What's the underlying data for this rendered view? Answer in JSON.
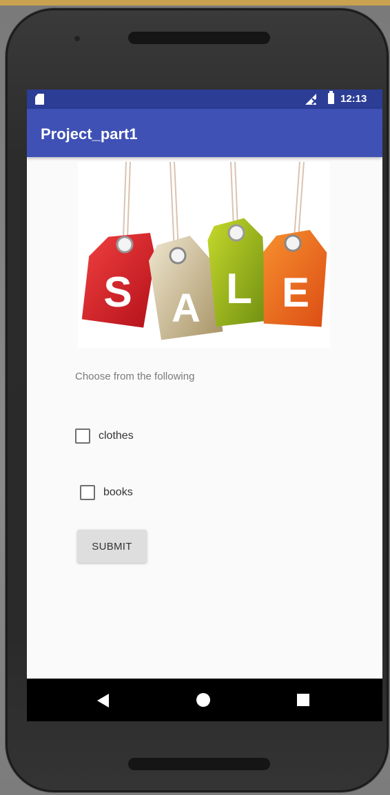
{
  "status_bar": {
    "time": "12:13",
    "icons": [
      "sd-card-icon",
      "signal-off-icon",
      "battery-icon"
    ]
  },
  "app_bar": {
    "title": "Project_part1"
  },
  "banner": {
    "tags": [
      {
        "letter": "S",
        "color": "#d8262b"
      },
      {
        "letter": "A",
        "color": "#c7b78f"
      },
      {
        "letter": "L",
        "color": "#8fb01c"
      },
      {
        "letter": "E",
        "color": "#ef6a1e"
      }
    ]
  },
  "form": {
    "prompt": "Choose from the following",
    "options": [
      {
        "label": "clothes",
        "checked": false
      },
      {
        "label": "books",
        "checked": false
      }
    ],
    "submit_label": "SUBMIT"
  },
  "nav_bar": {
    "icons": [
      "back-icon",
      "home-icon",
      "recents-icon"
    ]
  },
  "colors": {
    "status_bar": "#2c3d96",
    "app_bar": "#3f51b5",
    "background": "#fafafa",
    "button": "#dedede"
  }
}
